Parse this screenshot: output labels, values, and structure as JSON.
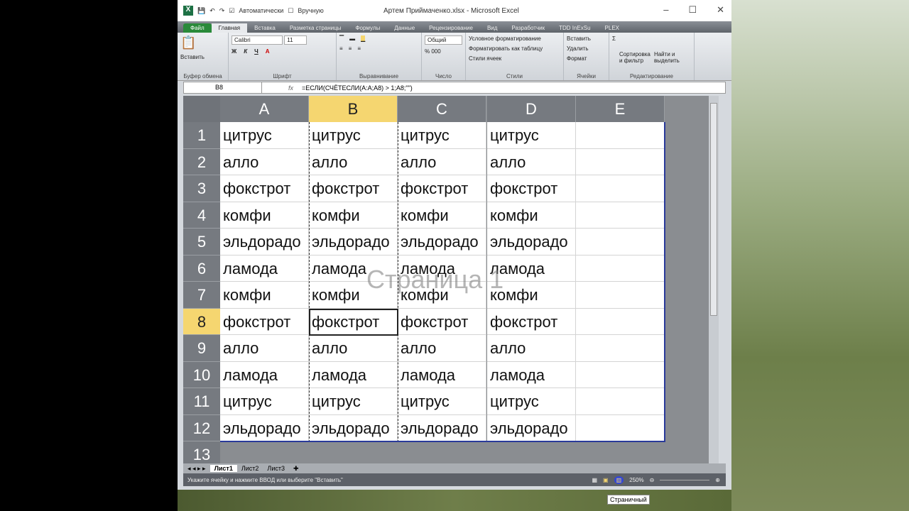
{
  "titlebar": {
    "title": "Артем Приймаченко.xlsx - Microsoft Excel",
    "auto": "Автоматически",
    "manual": "Вручную"
  },
  "tabs": [
    "Файл",
    "Главная",
    "Вставка",
    "Разметка страницы",
    "Формулы",
    "Данные",
    "Рецензирование",
    "Вид",
    "Разработчик",
    "TDD InExSu",
    "PLEX"
  ],
  "ribbon": {
    "paste": "Вставить",
    "clipboard": "Буфер обмена",
    "font_name": "Calibri",
    "font_size": "11",
    "font": "Шрифт",
    "align": "Выравнивание",
    "number_format": "Общий",
    "number": "Число",
    "cond": "Условное форматирование",
    "table": "Форматировать как таблицу",
    "cellstyles": "Стили ячеек",
    "styles": "Стили",
    "insert": "Вставить",
    "delete": "Удалить",
    "format": "Формат",
    "cells": "Ячейки",
    "sort": "Сортировка и фильтр",
    "find": "Найти и выделить",
    "editing": "Редактирование",
    "bold": "Ж",
    "italic": "К",
    "underline": "Ч"
  },
  "formula": {
    "name": "B8",
    "fx": "fx",
    "value": "=ЕСЛИ(СЧЁТЕСЛИ(A:A;A8) > 1;A8;\"\")"
  },
  "columns": [
    "A",
    "B",
    "C",
    "D",
    "E"
  ],
  "rows": [
    "1",
    "2",
    "3",
    "4",
    "5",
    "6",
    "7",
    "8",
    "9",
    "10",
    "11",
    "12",
    "13"
  ],
  "cells": [
    [
      "цитрус",
      "цитрус",
      "цитрус",
      "цитрус"
    ],
    [
      "алло",
      "алло",
      "алло",
      "алло"
    ],
    [
      "фокстрот",
      "фокстрот",
      "фокстрот",
      "фокстрот"
    ],
    [
      "комфи",
      "комфи",
      "комфи",
      "комфи"
    ],
    [
      "эльдорадо",
      "эльдорадо",
      "эльдорадо",
      "эльдорадо"
    ],
    [
      "ламода",
      "ламода",
      "ламода",
      "ламода"
    ],
    [
      "комфи",
      "комфи",
      "комфи",
      "комфи"
    ],
    [
      "фокстрот",
      "фокстрот",
      "фокстрот",
      "фокстрот"
    ],
    [
      "алло",
      "алло",
      "алло",
      "алло"
    ],
    [
      "ламода",
      "ламода",
      "ламода",
      "ламода"
    ],
    [
      "цитрус",
      "цитрус",
      "цитрус",
      "цитрус"
    ],
    [
      "эльдорадо",
      "эльдорадо",
      "эльдорадо",
      "эльдорадо"
    ]
  ],
  "page_label": "Страница 1",
  "sheets": [
    "Лист1",
    "Лист2",
    "Лист3"
  ],
  "status": {
    "text": "Укажите ячейку и нажмите ВВОД или выберите \"Вставить\"",
    "zoom": "250%",
    "tooltip": "Страничный"
  }
}
